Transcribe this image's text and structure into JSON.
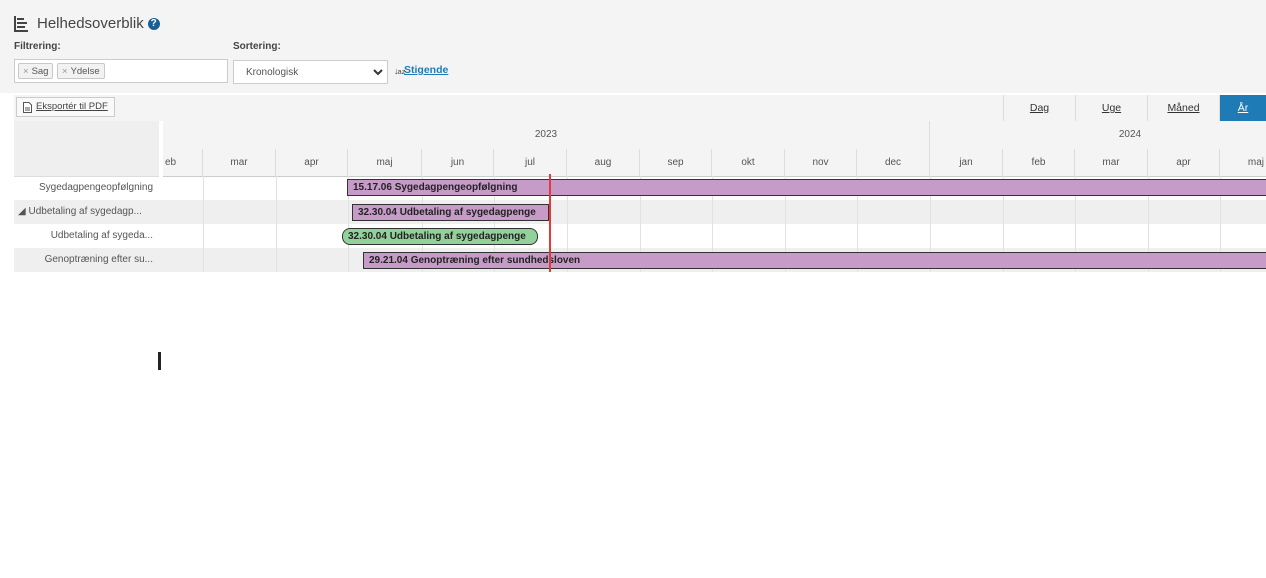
{
  "header": {
    "title": "Helhedsoverblik",
    "help_icon": "question-circle-icon",
    "filter_label": "Filtrering:",
    "filter_chips": [
      "Sag",
      "Ydelse"
    ],
    "sort_label": "Sortering:",
    "sort_value": "Kronologisk",
    "sort_direction_label": "Stigende"
  },
  "toolbar": {
    "export_label": "Eksportér til PDF",
    "views": [
      "Dag",
      "Uge",
      "Måned",
      "År"
    ],
    "active_view": "År"
  },
  "timeline": {
    "years": [
      "2023",
      "2024"
    ],
    "months": [
      "eb",
      "mar",
      "apr",
      "maj",
      "jun",
      "jul",
      "aug",
      "sep",
      "okt",
      "nov",
      "dec",
      "jan",
      "feb",
      "mar",
      "apr",
      "maj"
    ]
  },
  "rows": [
    {
      "label": "Sygedagpengeopfølgning",
      "bar": "15.17.06 Sygedagpengeopfølgning",
      "bar_type": "purple"
    },
    {
      "label": "◢ Udbetaling af sygedagp...",
      "bar": "32.30.04 Udbetaling af sygedagpenge",
      "bar_type": "purple"
    },
    {
      "label": "Udbetaling af sygeda...",
      "bar": "32.30.04 Udbetaling af sygedagpenge",
      "bar_type": "green"
    },
    {
      "label": "Genoptræning efter su...",
      "bar": "29.21.04 Genoptræning efter sundhedsloven",
      "bar_type": "purple"
    }
  ],
  "colors": {
    "accent": "#1f7bb6",
    "bar_purple": "#c79bc8",
    "bar_green": "#93d19a",
    "today_line": "#e23a3a"
  }
}
